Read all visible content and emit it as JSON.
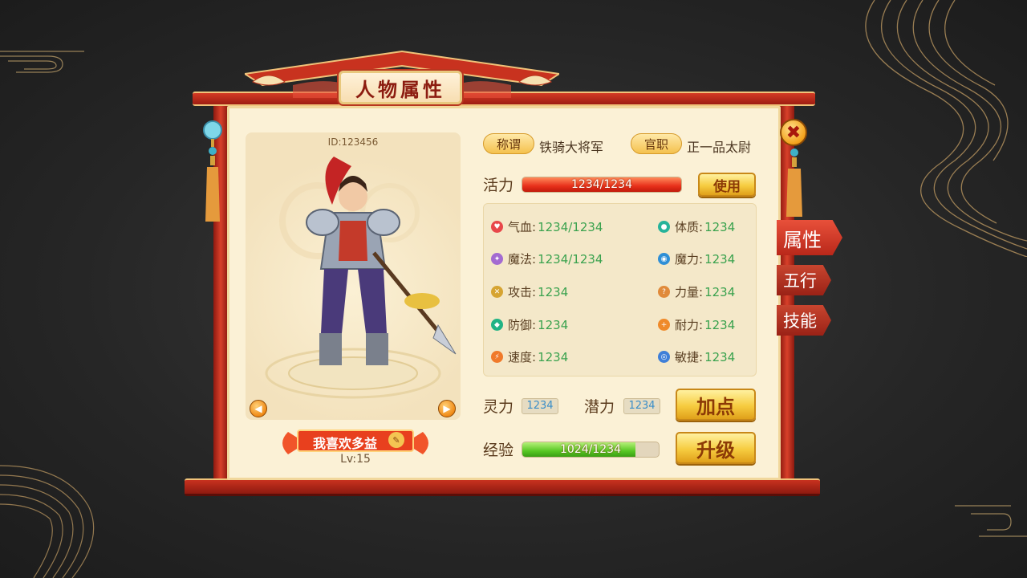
{
  "panel": {
    "title": "人物属性"
  },
  "character": {
    "id_text": "ID:123456",
    "name": "我喜欢多益",
    "level": "Lv:15"
  },
  "title_row": {
    "title_label": "称谓",
    "title_value": "铁骑大将军",
    "office_label": "官职",
    "office_value": "正一品太尉"
  },
  "vitality": {
    "label": "活力",
    "text": "1234/1234",
    "percent": 100,
    "use_button": "使用"
  },
  "stats": [
    {
      "icon": "heart-icon",
      "color": "#e8474a",
      "label": "气血:",
      "value": "1234/1234"
    },
    {
      "icon": "body-icon",
      "color": "#26b39a",
      "label": "体质:",
      "value": "1234"
    },
    {
      "icon": "magic-icon",
      "color": "#a36bd1",
      "label": "魔法:",
      "value": "1234/1234"
    },
    {
      "icon": "magic-power-icon",
      "color": "#2f8fd6",
      "label": "魔力:",
      "value": "1234"
    },
    {
      "icon": "attack-icon",
      "color": "#d6a432",
      "label": "攻击:",
      "value": "1234"
    },
    {
      "icon": "strength-icon",
      "color": "#e08a3a",
      "label": "力量:",
      "value": "1234"
    },
    {
      "icon": "defense-icon",
      "color": "#20b384",
      "label": "防御:",
      "value": "1234"
    },
    {
      "icon": "endurance-icon",
      "color": "#ef8a2a",
      "label": "耐力:",
      "value": "1234"
    },
    {
      "icon": "speed-icon",
      "color": "#f07a2a",
      "label": "速度:",
      "value": "1234"
    },
    {
      "icon": "agility-icon",
      "color": "#3f7fd8",
      "label": "敏捷:",
      "value": "1234"
    }
  ],
  "points": {
    "spirit_label": "灵力",
    "spirit_value": "1234",
    "potential_label": "潜力",
    "potential_value": "1234",
    "add_button": "加点"
  },
  "experience": {
    "label": "经验",
    "text": "1024/1234",
    "percent": 83,
    "upgrade_button": "升级"
  },
  "tabs": [
    {
      "label": "属性",
      "active": true
    },
    {
      "label": "五行",
      "active": false
    },
    {
      "label": "技能",
      "active": false
    }
  ],
  "colors": {
    "frame_red": "#c8321f",
    "accent_gold": "#f4c14e",
    "stat_value_green": "#3aa24e",
    "paper": "#fbf1d6"
  }
}
